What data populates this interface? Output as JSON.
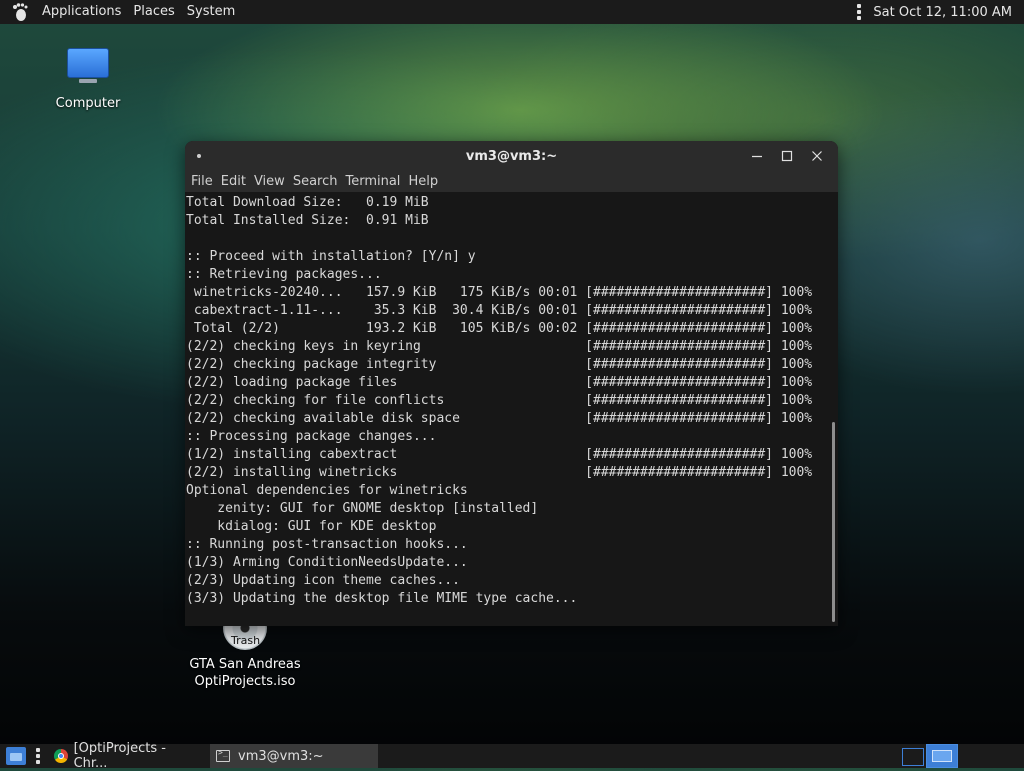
{
  "top_panel": {
    "menus": [
      "Applications",
      "Places",
      "System"
    ],
    "clock": "Sat Oct 12, 11:00 AM"
  },
  "desktop": {
    "computer_label": "Computer",
    "trash_label": "Trash",
    "gta_label_line1": "GTA San Andreas",
    "gta_label_line2": "OptiProjects.iso"
  },
  "terminal": {
    "title": "vm3@vm3:~",
    "menu": [
      "File",
      "Edit",
      "View",
      "Search",
      "Terminal",
      "Help"
    ],
    "output": "Total Download Size:   0.19 MiB\nTotal Installed Size:  0.91 MiB\n\n:: Proceed with installation? [Y/n] y\n:: Retrieving packages...\n winetricks-20240...   157.9 KiB   175 KiB/s 00:01 [######################] 100%\n cabextract-1.11-...    35.3 KiB  30.4 KiB/s 00:01 [######################] 100%\n Total (2/2)           193.2 KiB   105 KiB/s 00:02 [######################] 100%\n(2/2) checking keys in keyring                     [######################] 100%\n(2/2) checking package integrity                   [######################] 100%\n(2/2) loading package files                        [######################] 100%\n(2/2) checking for file conflicts                  [######################] 100%\n(2/2) checking available disk space                [######################] 100%\n:: Processing package changes...\n(1/2) installing cabextract                        [######################] 100%\n(2/2) installing winetricks                        [######################] 100%\nOptional dependencies for winetricks\n    zenity: GUI for GNOME desktop [installed]\n    kdialog: GUI for KDE desktop\n:: Running post-transaction hooks...\n(1/3) Arming ConditionNeedsUpdate...\n(2/3) Updating icon theme caches...\n(3/3) Updating the desktop file MIME type cache..."
  },
  "taskbar": {
    "items": [
      "[OptiProjects - Chr...",
      "vm3@vm3:~"
    ]
  },
  "icons": {
    "top_left": "gnome-foot-icon",
    "computer": "computer-monitor-icon",
    "trash": "disc-icon",
    "browser": "chrome-icon",
    "terminal": "terminal-icon"
  },
  "colors": {
    "accent": "#3d7fd6",
    "panel_bg": "#1b1b1b",
    "terminal_bg": "#171717",
    "titlebar_bg": "#2b2b2b"
  }
}
